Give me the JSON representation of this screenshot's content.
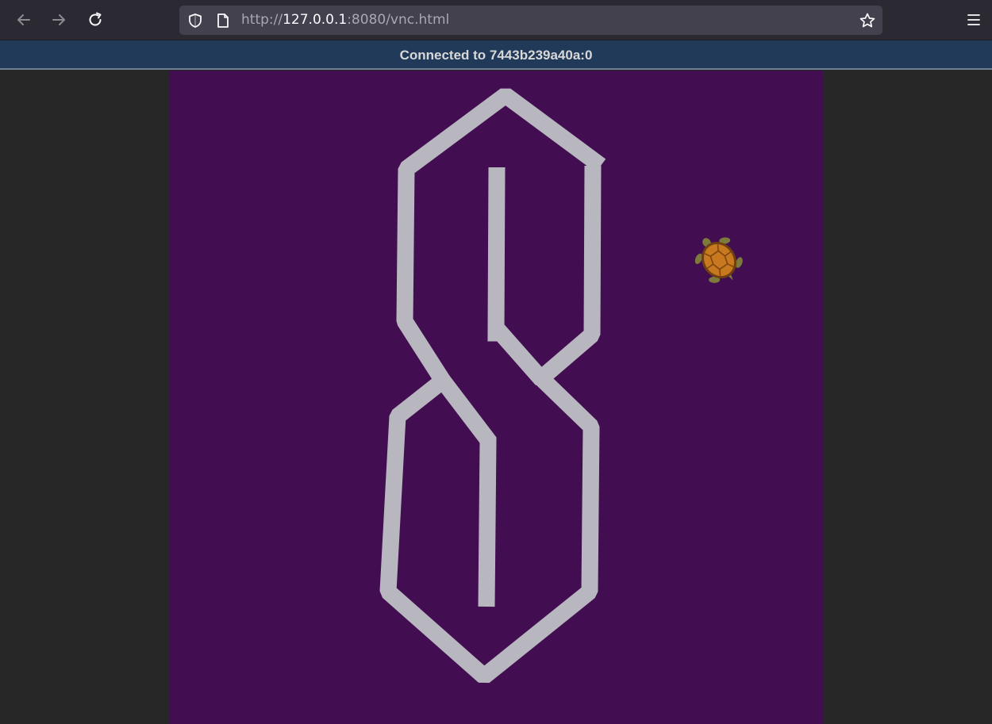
{
  "browser": {
    "url_prefix": "http://",
    "url_host": "127.0.0.1",
    "url_rest": ":8080/vnc.html",
    "icons": {
      "back": "back-arrow-icon",
      "forward": "forward-arrow-icon",
      "reload": "reload-icon",
      "shield": "shield-icon",
      "page": "page-icon",
      "bookmark": "star-icon",
      "menu": "hamburger-menu-icon"
    }
  },
  "vnc": {
    "status_text": "Connected to 7443b239a40a:0"
  },
  "colors": {
    "canvas_background": "#420e51",
    "drawing_stroke": "#b8b7bf",
    "status_bar": "#213a5a"
  }
}
